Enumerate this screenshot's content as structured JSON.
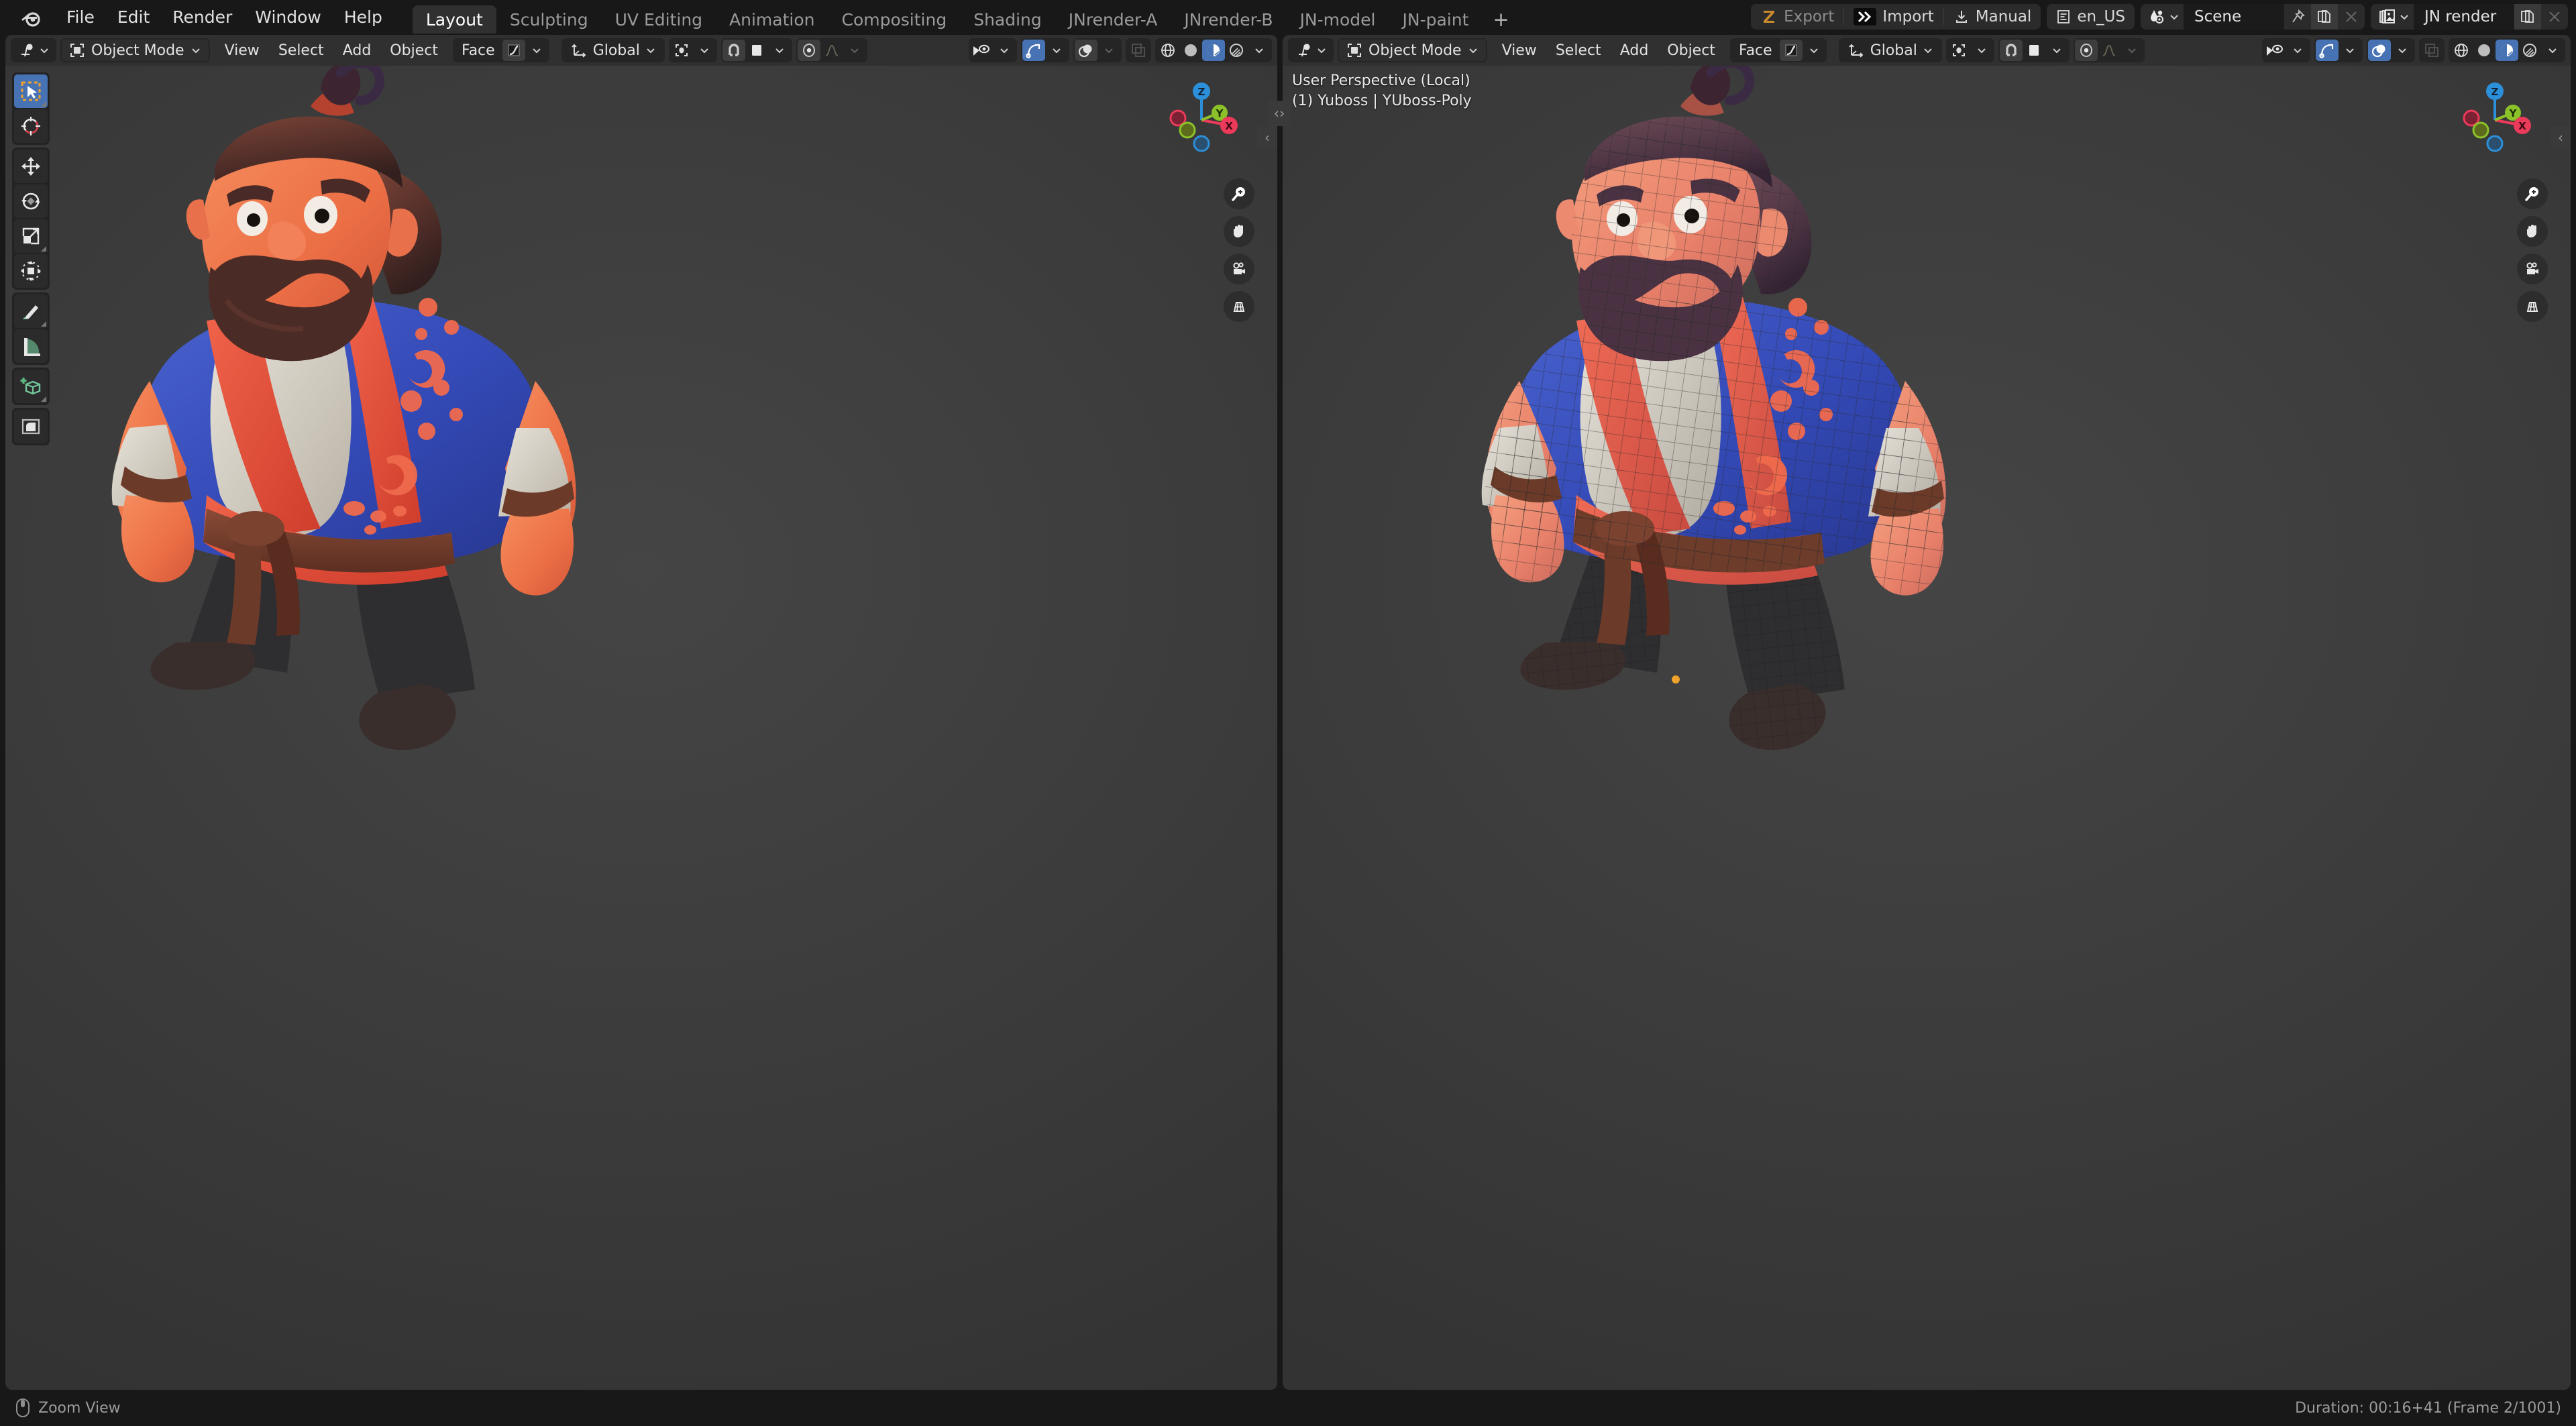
{
  "app": {
    "name": "Blender",
    "logo_icon": "blender-logo-icon"
  },
  "topbar": {
    "menus": [
      "File",
      "Edit",
      "Render",
      "Window",
      "Help"
    ],
    "workspace_tabs": [
      {
        "label": "Layout",
        "active": true
      },
      {
        "label": "Sculpting",
        "active": false
      },
      {
        "label": "UV Editing",
        "active": false
      },
      {
        "label": "Animation",
        "active": false
      },
      {
        "label": "Compositing",
        "active": false
      },
      {
        "label": "Shading",
        "active": false
      },
      {
        "label": "JNrender-A",
        "active": false
      },
      {
        "label": "JNrender-B",
        "active": false
      },
      {
        "label": "JN-model",
        "active": false
      },
      {
        "label": "JN-paint",
        "active": false
      }
    ],
    "add_workspace_label": "+",
    "right_tools": [
      {
        "label": "Export",
        "icon": "zbrush-z-icon",
        "dim": true
      },
      {
        "label": "Import",
        "icon": "double-chevron-right-icon",
        "dim": false
      },
      {
        "label": "Manual",
        "icon": "download-icon",
        "dim": false
      },
      {
        "label": "en_US",
        "icon": "text-lines-icon",
        "dim": false
      }
    ],
    "scene": {
      "icon": "scene-data-icon",
      "name": "Scene",
      "pin_icon": "pin-icon",
      "new_icon": "new-copy-icon",
      "delete_icon": "x-icon"
    },
    "view_layer": {
      "icon": "view-layer-icon",
      "name": "JN render",
      "new_icon": "new-copy-icon",
      "delete_icon": "x-icon"
    }
  },
  "viewport_left": {
    "header": {
      "editor_type_icon": "editor-type-3dview-icon",
      "mode": "Object Mode",
      "mode_icon": "object-mode-icon",
      "menus": [
        "View",
        "Select",
        "Add",
        "Object"
      ],
      "falloff_label": "Face",
      "transform_orientation": "Global",
      "transform_orientation_icon": "orientation-axes-icon",
      "pivot_icon": "pivot-point-icon",
      "snap_icon": "magnet-icon",
      "snap_target_icon": "snap-increment-icon",
      "proportional_icon": "proportional-edit-icon",
      "proportional_falloff_icon": "smooth-falloff-icon",
      "visibility_icon": "object-visibility-icon",
      "gizmo_icon": "gizmo-icon",
      "gizmo_on": true,
      "overlays_icon": "overlays-icon",
      "overlays_on": false,
      "xray_icon": "xray-toggle-icon",
      "shading_modes": [
        {
          "icon": "shading-wireframe-icon",
          "active": false
        },
        {
          "icon": "shading-solid-icon",
          "active": false
        },
        {
          "icon": "shading-material-preview-icon",
          "active": true
        },
        {
          "icon": "shading-rendered-icon",
          "active": false
        }
      ]
    },
    "toolbar": [
      {
        "icon": "tweak-select-box-icon",
        "active": true,
        "has_submenu": true
      },
      {
        "icon": "cursor-3d-icon",
        "active": false,
        "has_submenu": false
      },
      {
        "icon": "move-icon",
        "active": false,
        "has_submenu": false
      },
      {
        "icon": "rotate-icon",
        "active": false,
        "has_submenu": false
      },
      {
        "icon": "scale-icon",
        "active": false,
        "has_submenu": true
      },
      {
        "icon": "transform-icon",
        "active": false,
        "has_submenu": false
      },
      {
        "icon": "annotate-icon",
        "active": false,
        "has_submenu": true
      },
      {
        "icon": "measure-icon",
        "active": false,
        "has_submenu": false
      },
      {
        "icon": "add-cube-icon",
        "active": false,
        "has_submenu": true
      },
      {
        "icon": "bevel-icon",
        "active": false,
        "has_submenu": false
      }
    ],
    "gizmo": {
      "axes": [
        "Z",
        "Y",
        "X"
      ],
      "colors": {
        "x": "#ec3a5a",
        "y": "#8bc22a",
        "z": "#2c8fd9"
      }
    },
    "nav_buttons": [
      "zoom-icon",
      "pan-hand-icon",
      "camera-view-icon",
      "toggle-perspective-icon"
    ]
  },
  "viewport_right": {
    "header": {
      "editor_type_icon": "editor-type-3dview-icon",
      "mode": "Object Mode",
      "mode_icon": "object-mode-icon",
      "menus": [
        "View",
        "Select",
        "Add",
        "Object"
      ],
      "falloff_label": "Face",
      "transform_orientation": "Global",
      "transform_orientation_icon": "orientation-axes-icon",
      "pivot_icon": "pivot-point-icon",
      "snap_icon": "magnet-icon",
      "proportional_icon": "proportional-edit-icon",
      "proportional_falloff_icon": "smooth-falloff-icon",
      "visibility_icon": "object-visibility-icon",
      "gizmo_icon": "gizmo-icon",
      "gizmo_on": true,
      "overlays_icon": "overlays-icon",
      "overlays_on": true,
      "xray_icon": "xray-toggle-icon",
      "shading_modes": [
        {
          "icon": "shading-wireframe-icon",
          "active": false
        },
        {
          "icon": "shading-solid-icon",
          "active": false
        },
        {
          "icon": "shading-material-preview-icon",
          "active": true
        },
        {
          "icon": "shading-rendered-icon",
          "active": false
        }
      ]
    },
    "overlay_text_line1": "User Perspective (Local)",
    "overlay_text_line2": "(1) Yuboss | YUboss-Poly",
    "gizmo": {
      "axes": [
        "Z",
        "Y",
        "X"
      ],
      "colors": {
        "x": "#ec3a5a",
        "y": "#8bc22a",
        "z": "#2c8fd9"
      }
    },
    "nav_buttons": [
      "zoom-icon",
      "pan-hand-icon",
      "camera-view-icon",
      "toggle-perspective-icon"
    ]
  },
  "statusbar": {
    "mouse_icon": "mouse-middle-button-icon",
    "hint": "Zoom View",
    "info": "Duration: 00:16+41 (Frame 2/1001)"
  },
  "colors": {
    "accent_blue": "#4772b3",
    "header_bg": "#303030",
    "topbar_bg": "#181818",
    "viewport_bg": "#3b3b3b",
    "axis_x": "#ec3a5a",
    "axis_y": "#8bc22a",
    "axis_z": "#2c8fd9",
    "skin": "#f07a52",
    "robe_blue": "#3350b8",
    "robe_red": "#e8523c",
    "robe_white": "#d8d2c8",
    "hair_dark": "#4a2b2b"
  }
}
